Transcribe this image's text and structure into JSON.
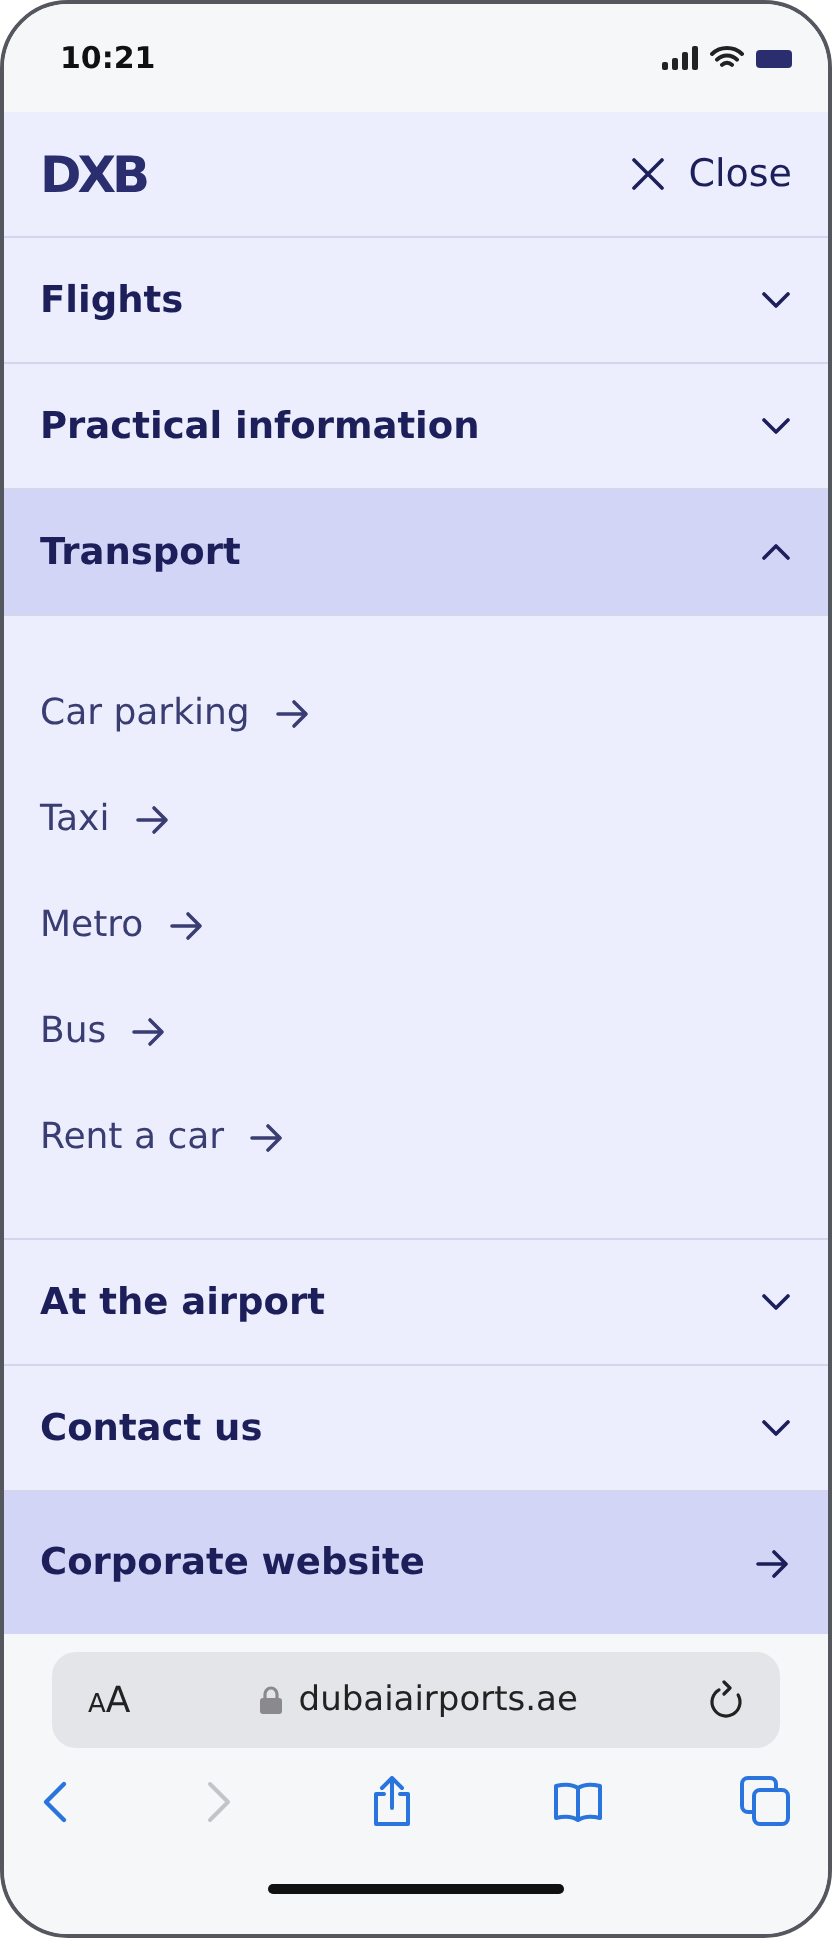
{
  "status_bar": {
    "time": "10:21"
  },
  "header": {
    "logo": "DXB",
    "close_label": "Close"
  },
  "menu": [
    {
      "kind": "accordion",
      "label": "Flights",
      "expanded": false
    },
    {
      "kind": "accordion",
      "label": "Practical information",
      "expanded": false
    },
    {
      "kind": "accordion",
      "label": "Transport",
      "expanded": true,
      "children": [
        {
          "label": "Car parking"
        },
        {
          "label": "Taxi"
        },
        {
          "label": "Metro"
        },
        {
          "label": "Bus"
        },
        {
          "label": "Rent a car"
        }
      ]
    },
    {
      "kind": "accordion",
      "label": "At the airport",
      "expanded": false
    },
    {
      "kind": "accordion",
      "label": "Contact us",
      "expanded": false
    },
    {
      "kind": "link",
      "label": "Corporate website"
    }
  ],
  "browser": {
    "text_size": "AA",
    "url": "dubaiairports.ae",
    "back_disabled": false,
    "forward_disabled": true
  }
}
